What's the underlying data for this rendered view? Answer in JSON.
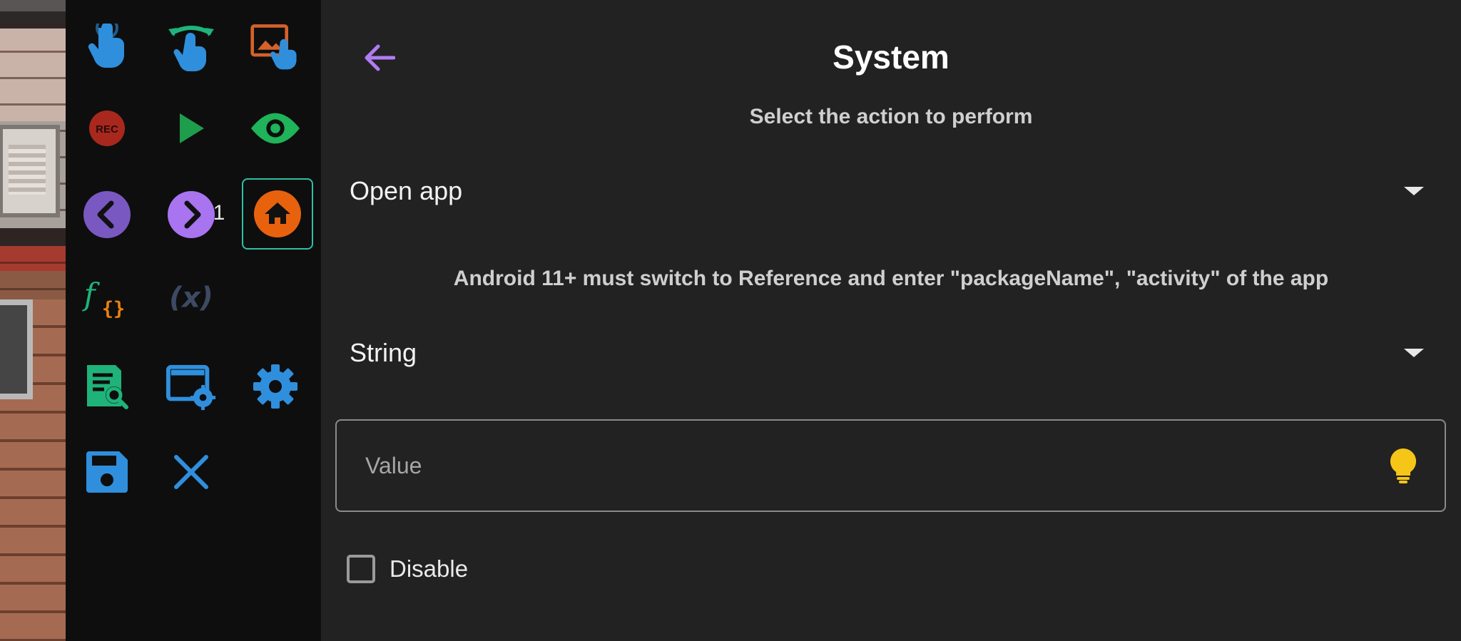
{
  "header": {
    "title": "System",
    "subtitle": "Select the action to perform"
  },
  "action_dropdown": {
    "selected": "Open app"
  },
  "note": "Android 11+ must switch to Reference and enter \"packageName\", \"activity\" of the app",
  "type_dropdown": {
    "selected": "String"
  },
  "value_field": {
    "value": "",
    "placeholder": "Value"
  },
  "disable_checkbox": {
    "label": "Disable",
    "checked": false
  },
  "toolbar": {
    "page_number": "1",
    "icons": [
      "tap-icon",
      "swipe-icon",
      "image-tap-icon",
      "record-icon",
      "play-icon",
      "eye-icon",
      "previous-icon",
      "next-icon",
      "home-icon",
      "function-icon",
      "variable-icon",
      "log-search-icon",
      "screen-settings-icon",
      "settings-icon",
      "save-icon",
      "close-icon"
    ],
    "active_icon": "home-icon"
  },
  "colors": {
    "accent": "#b07cf2",
    "panel_bg": "#222222",
    "toolbar_bg": "#0e0e0e",
    "home_orange": "#e8620e",
    "bulb_yellow": "#f5c518",
    "blue": "#2f8fdd",
    "green": "#1fb37a"
  }
}
